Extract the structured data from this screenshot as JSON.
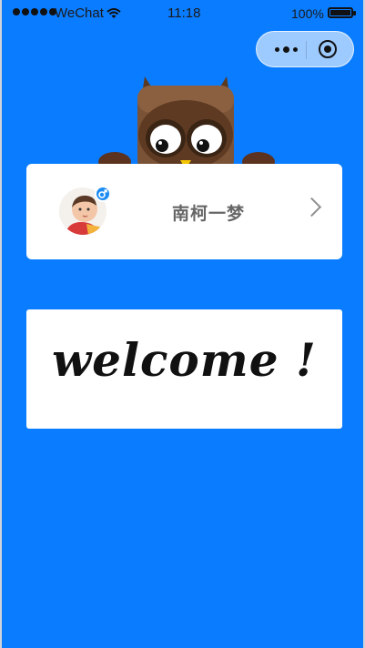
{
  "status_bar": {
    "carrier": "WeChat",
    "time": "11:18",
    "battery": "100%"
  },
  "capsule": {
    "more_icon": "more-dots-icon",
    "close_icon": "target-icon"
  },
  "colors": {
    "background": "#0a7cff",
    "card": "#ffffff",
    "gender_badge": "#1d8cf2"
  },
  "user": {
    "nickname": "南柯一梦",
    "gender_icon": "male-icon"
  },
  "welcome": {
    "text": "welcome !"
  }
}
